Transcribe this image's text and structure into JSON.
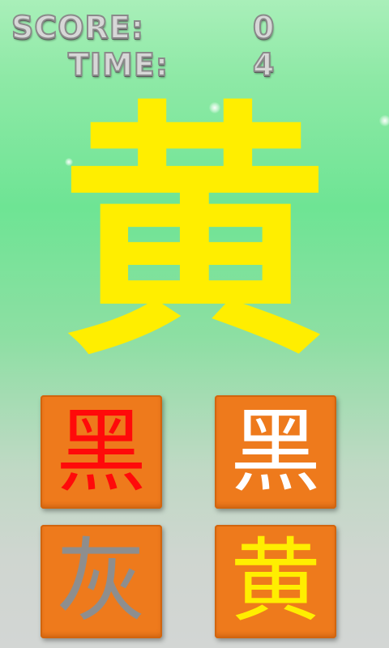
{
  "hud": {
    "score_label": "SCORE:",
    "score_value": "0",
    "time_label": "TIME:",
    "time_value": "4"
  },
  "target": {
    "char": "黄",
    "color": "#ffee00"
  },
  "options": [
    {
      "char": "黑",
      "color": "#ff0a0a"
    },
    {
      "char": "黑",
      "color": "#ffffff"
    },
    {
      "char": "灰",
      "color": "#8e8e8e"
    },
    {
      "char": "黄",
      "color": "#ffee00"
    }
  ],
  "colors": {
    "tile": "#ee7a1c"
  }
}
